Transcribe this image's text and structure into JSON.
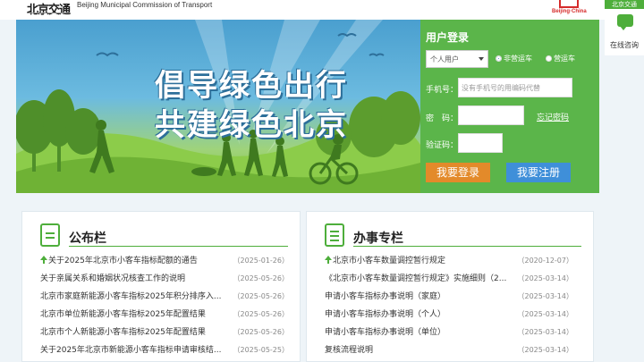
{
  "header": {
    "logo_text": "北京交通",
    "commission": "Beijing Municipal Commission of Transport",
    "beijing_china": "Beijing·China"
  },
  "side_widget": {
    "tag": "北京交通",
    "label": "在线咨询",
    "icon": "chat-bubble-icon"
  },
  "banner": {
    "slogan_line1": "倡导绿色出行",
    "slogan_line2": "共建绿色北京"
  },
  "login": {
    "title": "用户登录",
    "user_type": "个人用户",
    "radio_non_operating": "非营运车",
    "radio_operating": "营运车",
    "phone_label": "手机号：",
    "phone_placeholder": "没有手机号的用编码代替",
    "password_label": "密　码：",
    "forgot": "忘记密码",
    "captcha_label": "验证码：",
    "login_button": "我要登录",
    "register_button": "我要注册",
    "accent": "#5bb54a"
  },
  "bulletin": {
    "title": "公布栏",
    "items": [
      {
        "text": "关于2025年北京市小客车指标配额的通告",
        "date": "（2025-01-26）",
        "pinned": true
      },
      {
        "text": "关于亲属关系和婚姻状况核查工作的说明",
        "date": "（2025-05-26）",
        "pinned": false
      },
      {
        "text": "北京市家庭新能源小客车指标2025年积分排序入...",
        "date": "（2025-05-26）",
        "pinned": false
      },
      {
        "text": "北京市单位新能源小客车指标2025年配置结果",
        "date": "（2025-05-26）",
        "pinned": false
      },
      {
        "text": "北京市个人新能源小客车指标2025年配置结果",
        "date": "（2025-05-26）",
        "pinned": false
      },
      {
        "text": "关于2025年北京市新能源小客车指标申请审核结...",
        "date": "（2025-05-25）",
        "pinned": false
      }
    ]
  },
  "service": {
    "title": "办事专栏",
    "items": [
      {
        "text": "北京市小客车数量调控暂行规定",
        "date": "（2020-12-07）",
        "pinned": true
      },
      {
        "text": "《北京市小客车数量调控暂行规定》实施细则（2...",
        "date": "（2025-03-14）",
        "pinned": false
      },
      {
        "text": "申请小客车指标办事说明（家庭）",
        "date": "（2025-03-14）",
        "pinned": false
      },
      {
        "text": "申请小客车指标办事说明（个人）",
        "date": "（2025-03-14）",
        "pinned": false
      },
      {
        "text": "申请小客车指标办事说明（单位）",
        "date": "（2025-03-14）",
        "pinned": false
      },
      {
        "text": "复核流程说明",
        "date": "（2025-03-14）",
        "pinned": false
      }
    ]
  }
}
